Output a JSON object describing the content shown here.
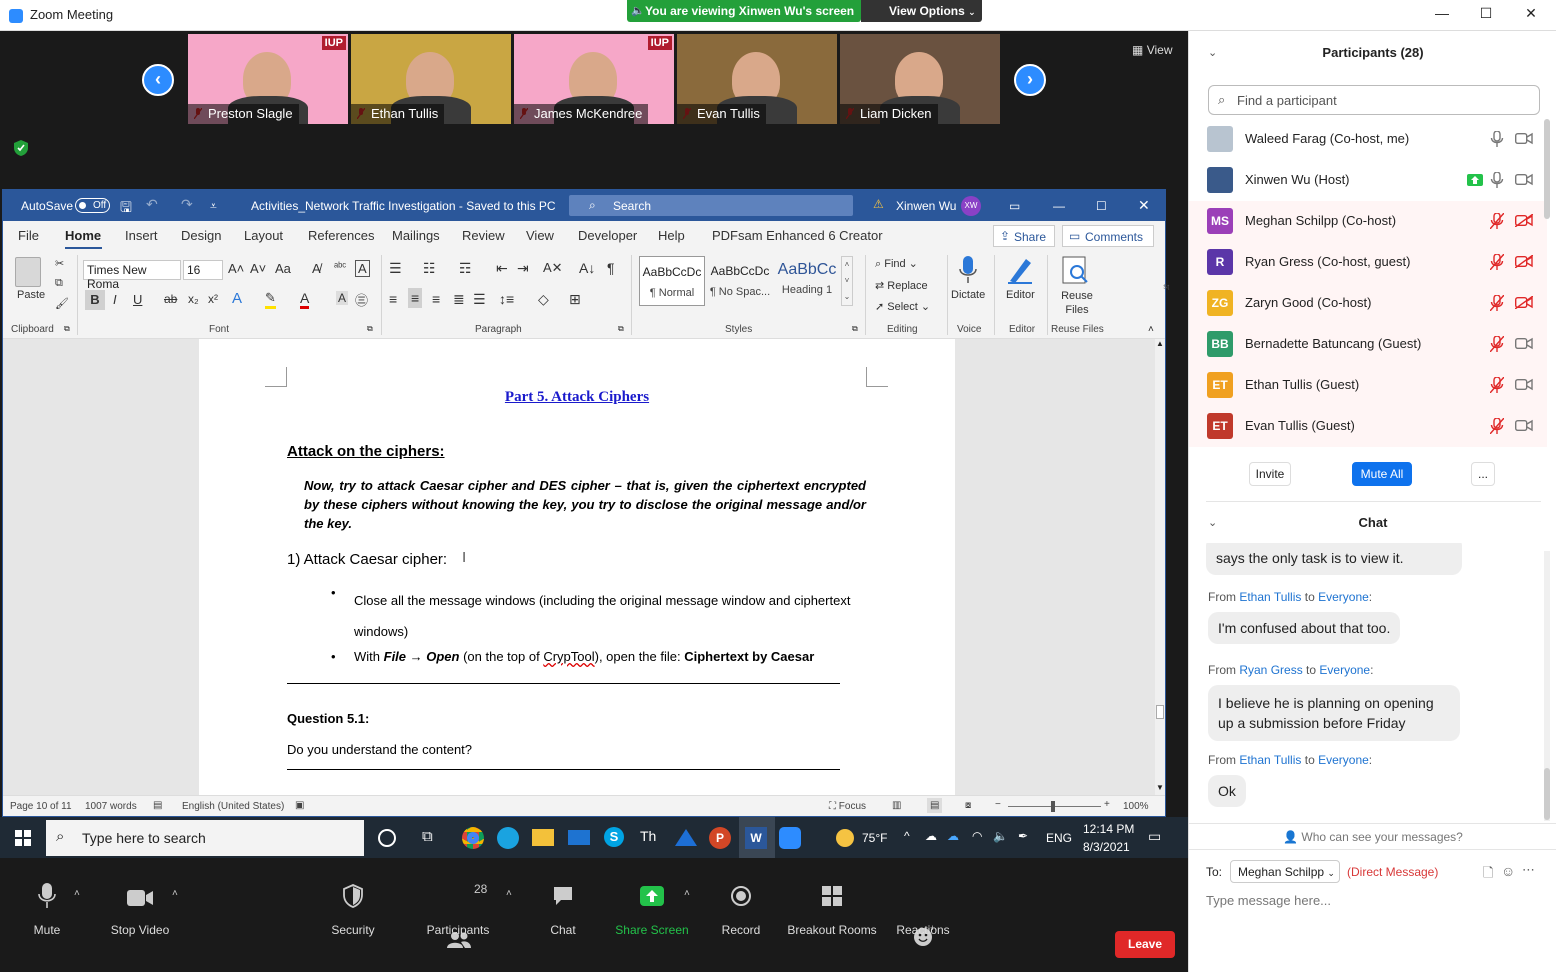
{
  "zoom_window": {
    "title": "Zoom Meeting",
    "banner": "You are viewing Xinwen Wu's screen",
    "view_options": "View Options"
  },
  "video_tiles": [
    {
      "name": "Preston Slagle",
      "bg": "#f6a7c8"
    },
    {
      "name": "Ethan Tullis",
      "bg": "#c9a643"
    },
    {
      "name": "James McKendree",
      "bg": "#f6a7c8"
    },
    {
      "name": "Evan Tullis",
      "bg": "#8a6a3c"
    },
    {
      "name": "Liam Dicken",
      "bg": "#6a5240"
    }
  ],
  "tile_logo_text": "IUP",
  "view_label": "View",
  "word": {
    "autosave": "AutoSave",
    "autosave_state": "Off",
    "doc_title": "Activities_Network Traffic Investigation  -  Saved to this PC",
    "search_placeholder": "Search",
    "user_name": "Xinwen Wu",
    "user_initials": "XW",
    "tabs": [
      "File",
      "Home",
      "Insert",
      "Design",
      "Layout",
      "References",
      "Mailings",
      "Review",
      "View",
      "Developer",
      "Help",
      "PDFsam Enhanced 6 Creator"
    ],
    "share": "Share",
    "comments": "Comments",
    "ribbon": {
      "paste": "Paste",
      "clipboard": "Clipboard",
      "font_name": "Times New Roma",
      "font_size": "16",
      "font_group": "Font",
      "paragraph_group": "Paragraph",
      "styles": [
        {
          "preview": "AaBbCcDc",
          "name": "¶ Normal"
        },
        {
          "preview": "AaBbCcDc",
          "name": "¶ No Spac..."
        },
        {
          "preview": "AaBbCc",
          "name": "Heading 1"
        }
      ],
      "styles_group": "Styles",
      "find": "Find",
      "replace": "Replace",
      "select": "Select",
      "editing_group": "Editing",
      "dictate": "Dictate",
      "voice_group": "Voice",
      "editor": "Editor",
      "editor_group": "Editor",
      "reuse_files": "Reuse Files",
      "reuse_group": "Reuse Files"
    },
    "document": {
      "heading": "Part 5.  Attack Ciphers",
      "subheading": "Attack on the ciphers:",
      "intro": "Now, try to attack Caesar cipher and DES cipher – that is, given the ciphertext encrypted by these ciphers without knowing the key, you try to disclose the original message and/or the key.",
      "step": "1)  Attack Caesar cipher:",
      "bullet1": "Close all the message windows (including the original message window and ciphertext windows)",
      "bullet2_pre": "With ",
      "bullet2_file": "File → Open",
      "bullet2_mid": " (on the top of ",
      "bullet2_tool": "CrypTool",
      "bullet2_post": "), open the file: ",
      "bullet2_bold": "Ciphertext by Caesar",
      "question_title": "Question 5.1:",
      "question_text": "Do you understand the content?"
    },
    "status": {
      "page": "Page 10 of 11",
      "words": "1007 words",
      "language": "English (United States)",
      "focus": "Focus",
      "zoom": "100%"
    }
  },
  "taskbar": {
    "search_placeholder": "Type here to search",
    "weather": "75°F",
    "lang": "ENG",
    "time": "12:14 PM",
    "date": "8/3/2021"
  },
  "controls": {
    "mute": "Mute",
    "stop_video": "Stop Video",
    "security": "Security",
    "participants": "Participants",
    "participants_count": "28",
    "chat": "Chat",
    "share_screen": "Share Screen",
    "record": "Record",
    "breakout": "Breakout Rooms",
    "reactions": "Reactions",
    "leave": "Leave"
  },
  "participants_panel": {
    "title": "Participants (28)",
    "find_placeholder": "Find a participant",
    "list": [
      {
        "name": "Waleed Farag (Co-host, me)",
        "initials": "",
        "color": "#b8c4d0",
        "muted": false,
        "video_off": false,
        "sharing": false
      },
      {
        "name": "Xinwen Wu (Host)",
        "initials": "",
        "color": "#3a5a8a",
        "muted": false,
        "video_off": false,
        "sharing": true
      },
      {
        "name": "Meghan Schilpp (Co-host)",
        "initials": "MS",
        "color": "#9b3fb8",
        "muted": true,
        "video_off": true,
        "sharing": false
      },
      {
        "name": "Ryan Gress (Co-host, guest)",
        "initials": "R",
        "color": "#5b36a8",
        "muted": true,
        "video_off": true,
        "sharing": false
      },
      {
        "name": "Zaryn Good (Co-host)",
        "initials": "ZG",
        "color": "#f0b323",
        "muted": true,
        "video_off": true,
        "sharing": false
      },
      {
        "name": "Bernadette Batuncang (Guest)",
        "initials": "BB",
        "color": "#2f9b6a",
        "muted": true,
        "video_off": false,
        "sharing": false
      },
      {
        "name": "Ethan Tullis (Guest)",
        "initials": "ET",
        "color": "#f0a020",
        "muted": true,
        "video_off": false,
        "sharing": false
      },
      {
        "name": "Evan Tullis (Guest)",
        "initials": "ET",
        "color": "#c0392b",
        "muted": true,
        "video_off": false,
        "sharing": false
      }
    ],
    "invite": "Invite",
    "mute_all": "Mute All",
    "more": "..."
  },
  "chat_panel": {
    "title": "Chat",
    "messages": [
      {
        "from": "",
        "to": "",
        "text": "says the only task is to view it."
      },
      {
        "from": "Ethan Tullis",
        "to": "Everyone",
        "text": "I'm confused about that too."
      },
      {
        "from": "Ryan Gress",
        "to": "Everyone",
        "text": "I believe he is planning on opening up a submission before Friday"
      },
      {
        "from": "Ethan Tullis",
        "to": "Everyone",
        "text": "Ok"
      }
    ],
    "from_word": "From",
    "to_word": "to",
    "who_can_see": "Who can see your messages?",
    "to_label": "To:",
    "recipient": "Meghan Schilpp",
    "dm_label": "(Direct Message)",
    "input_placeholder": "Type message here..."
  }
}
